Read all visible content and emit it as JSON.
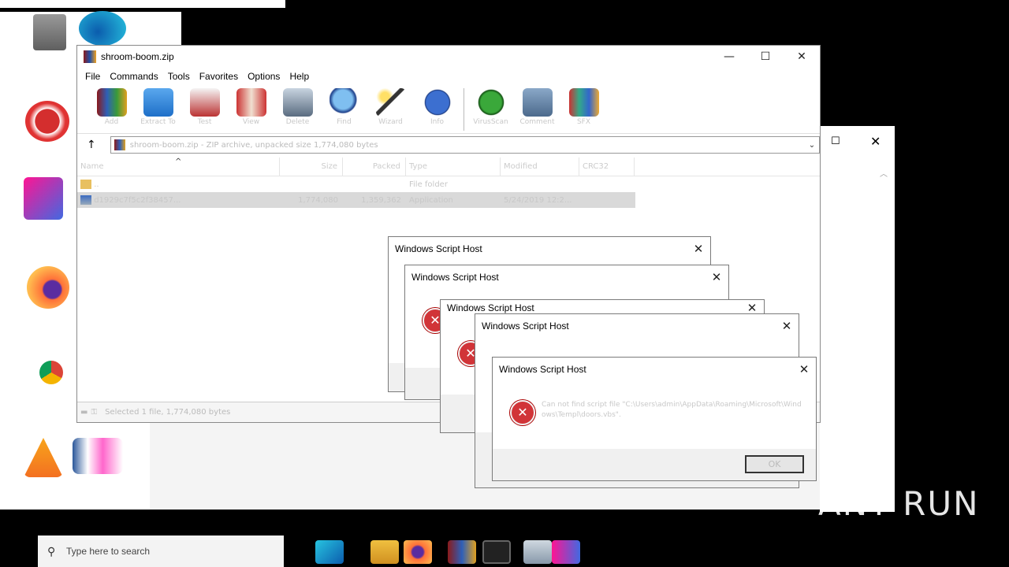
{
  "desktop": {
    "icons": [
      {
        "name": "Recycle Bin"
      },
      {
        "name": "Microsoft Edge"
      },
      {
        "name": "CCleaner"
      },
      {
        "name": "Adobe Acrobat"
      },
      {
        "name": "Firefox"
      },
      {
        "name": "Google Chrome"
      },
      {
        "name": "VLC media player"
      },
      {
        "name": "Word"
      }
    ]
  },
  "winrar": {
    "title": "shroom-boom.zip",
    "menu": [
      "File",
      "Commands",
      "Tools",
      "Favorites",
      "Options",
      "Help"
    ],
    "toolbar": [
      "Add",
      "Extract To",
      "Test",
      "View",
      "Delete",
      "Find",
      "Wizard",
      "Info",
      "VirusScan",
      "Comment",
      "SFX"
    ],
    "address": "shroom-boom.zip - ZIP archive, unpacked size 1,774,080 bytes",
    "columns": [
      "Name",
      "Size",
      "Packed",
      "Type",
      "Modified",
      "CRC32"
    ],
    "rows": [
      {
        "name": "..",
        "size": "",
        "packed": "",
        "type": "File folder",
        "modified": "",
        "crc": ""
      },
      {
        "name": "d1929c7f5c2f38457...",
        "size": "1,774,080",
        "packed": "1,359,362",
        "type": "Application",
        "modified": "5/24/2019 12:2...",
        "crc": ""
      }
    ],
    "status": "Selected 1 file, 1,774,080 bytes"
  },
  "dialogs": [
    {
      "title": "Windows Script Host"
    },
    {
      "title": "Windows Script Host"
    },
    {
      "title": "Windows Script Host"
    },
    {
      "title": "Windows Script Host"
    },
    {
      "title": "Windows Script Host",
      "message": "Can not find script file \"C:\\Users\\admin\\AppData\\Roaming\\Microsoft\\Windows\\Templ\\doors.vbs\".",
      "ok": "OK"
    }
  ],
  "taskbar": {
    "search_placeholder": "Type here to search"
  },
  "watermark": "ANY RUN"
}
